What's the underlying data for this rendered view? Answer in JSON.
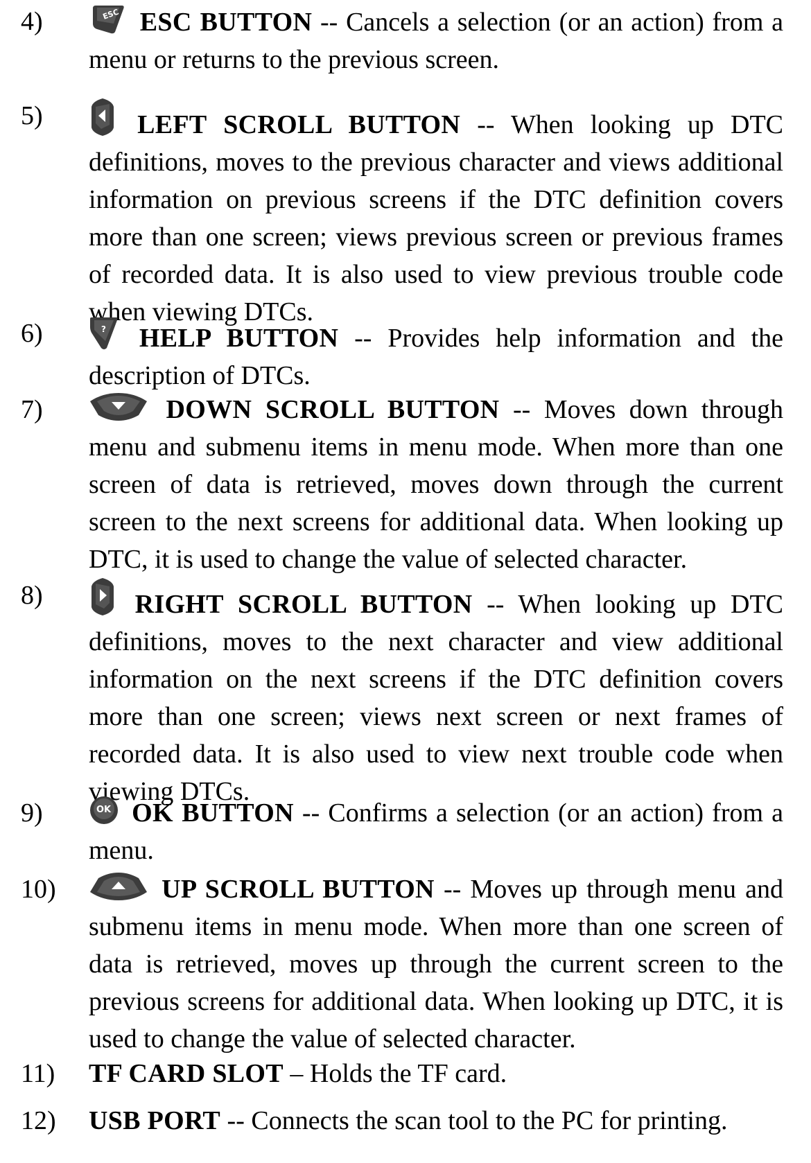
{
  "items": [
    {
      "number": "4)",
      "icon": "esc-button-icon",
      "icon_text": "ESC",
      "title": "ESC BUTTON",
      "separator": " -- ",
      "description": "Cancels a selection (or an action) from a menu or returns to the previous screen."
    },
    {
      "number": "5)",
      "icon": "left-scroll-button-icon",
      "title": "LEFT SCROLL BUTTON",
      "separator": " -- ",
      "description": "When looking up DTC definitions, moves to the previous character and views additional information on previous screens if the DTC definition covers more than one screen; views previous screen or previous frames of recorded data. It is also used to view previous trouble code when viewing DTCs."
    },
    {
      "number": "6)",
      "icon": "help-button-icon",
      "icon_text": "?",
      "title": "HELP BUTTON",
      "separator": " -- ",
      "description": "Provides help information and the description of DTCs."
    },
    {
      "number": "7)",
      "icon": "down-scroll-button-icon",
      "title": "DOWN SCROLL BUTTON",
      "separator": " -- ",
      "description": "Moves down through menu and submenu items in menu mode. When more than one screen of data is retrieved, moves down through the current screen to the next screens for additional data. When looking up DTC, it is used to change the value of selected character."
    },
    {
      "number": "8)",
      "icon": "right-scroll-button-icon",
      "title": "RIGHT SCROLL BUTTON",
      "separator": " -- ",
      "description": "When looking up DTC definitions, moves to the next character and view additional information on the next screens if the DTC definition covers more than one screen; views next screen or next frames of recorded data. It is also used to view next trouble code when viewing DTCs."
    },
    {
      "number": "9)",
      "icon": "ok-button-icon",
      "icon_text": "OK",
      "title": "OK BUTTON",
      "separator": " -- ",
      "description": "Confirms a selection (or an action) from a menu."
    },
    {
      "number": "10)",
      "icon": "up-scroll-button-icon",
      "title": "UP SCROLL BUTTON",
      "separator": " -- ",
      "description": "Moves up through menu and submenu items in menu mode. When more than one screen of data is retrieved, moves up through the current screen to the previous screens for additional data. When looking up DTC, it is used to change the value of selected character."
    },
    {
      "number": "11)",
      "title": "TF CARD SLOT",
      "separator": " – ",
      "description": "Holds the TF card."
    },
    {
      "number": "12)",
      "title": "USB PORT",
      "separator": " -- ",
      "description": "Connects the scan tool to the PC for printing."
    }
  ]
}
